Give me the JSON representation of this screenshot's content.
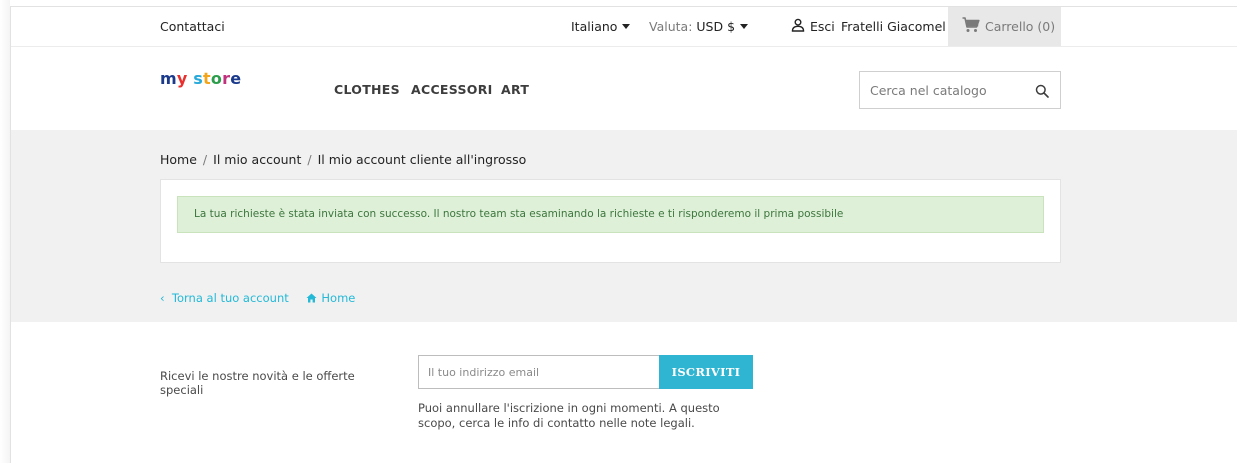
{
  "topbar": {
    "contact": "Contattaci",
    "language": "Italiano",
    "currency_label": "Valuta:",
    "currency_value": "USD $",
    "logout": "Esci",
    "username": "Fratelli Giacomel",
    "cart": "Carrello (0)"
  },
  "header": {
    "logo": {
      "my": "my",
      "store": "store"
    },
    "nav": [
      "CLOTHES",
      "ACCESSORI",
      "ART"
    ],
    "search_placeholder": "Cerca nel catalogo"
  },
  "breadcrumb": [
    "Home",
    "Il mio account",
    "Il mio account cliente all'ingrosso"
  ],
  "alert": "La tua richieste è stata inviata con successo. Il nostro team sta esaminando la richieste e ti risponderemo il prima possibile",
  "links": {
    "back": "Torna al tuo account",
    "home": "Home"
  },
  "newsletter": {
    "text": "Ricevi le nostre novità e le offerte speciali",
    "input_placeholder": "Il tuo indirizzo email",
    "button": "ISCRIVITI",
    "note": "Puoi annullare l'iscrizione in ogni momenti. A questo scopo, cerca le info di contatto nelle note legali."
  },
  "colors": {
    "accent": "#2fb5d2",
    "success_bg": "#dff0d8",
    "success_text": "#3c763d"
  }
}
